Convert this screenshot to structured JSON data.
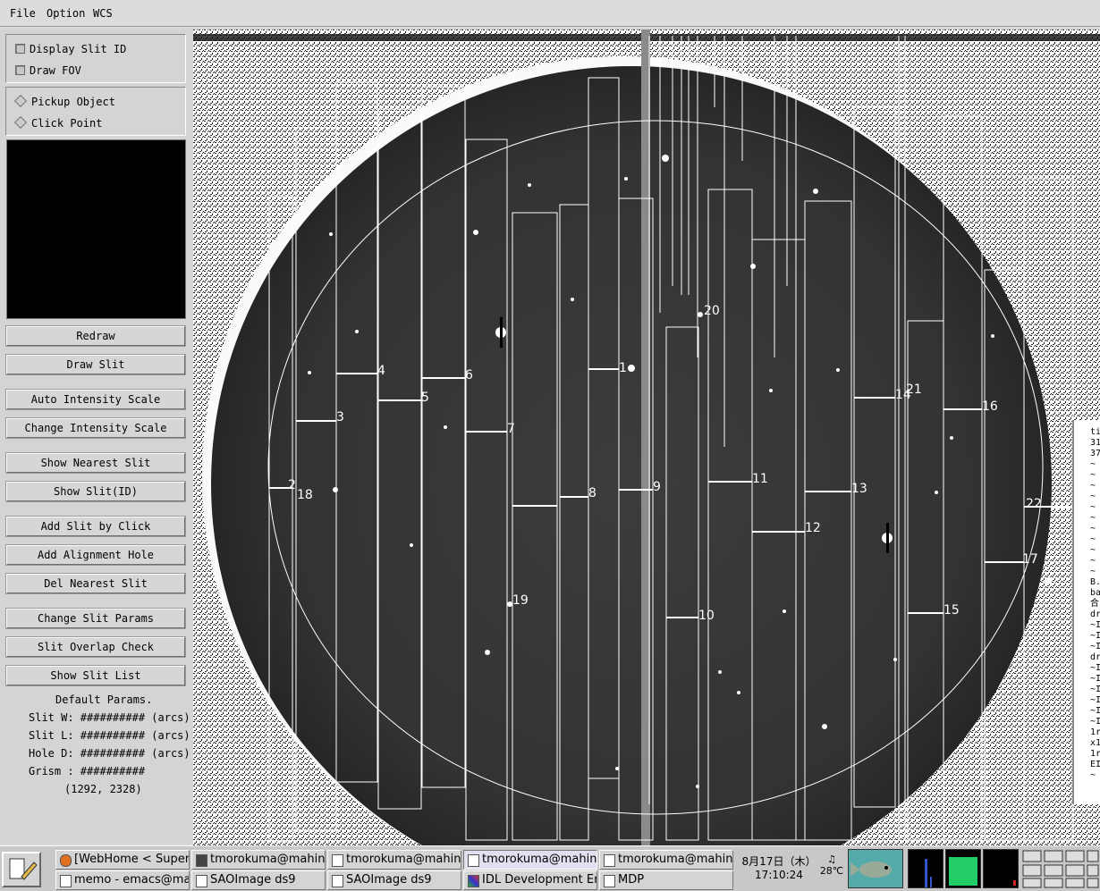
{
  "menu": [
    "File",
    "Option",
    "WCS"
  ],
  "options": {
    "display_slit_id": "Display Slit ID",
    "draw_fov": "Draw FOV",
    "pickup_object": "Pickup Object",
    "click_point": "Click Point"
  },
  "buttons": {
    "redraw": "Redraw",
    "draw_slit": "Draw Slit",
    "auto_intensity": "Auto Intensity Scale",
    "change_intensity": "Change Intensity Scale",
    "show_nearest": "Show Nearest Slit",
    "show_slit_id": "Show Slit(ID)",
    "add_slit_click": "Add Slit by Click",
    "add_alignment_hole": "Add Alignment Hole",
    "del_nearest": "Del Nearest Slit",
    "change_slit_params": "Change Slit Params",
    "overlap_check": "Slit Overlap Check",
    "show_slit_list": "Show Slit List"
  },
  "params": {
    "title": "Default Params.",
    "slit_w": "Slit W: ########## (arcs)",
    "slit_l": "Slit L: ########## (arcs)",
    "hole_d": "Hole D: ########## (arcs)",
    "grism": "Grism : ##########",
    "coords": "(1292, 2328)"
  },
  "slit_labels": [
    "1",
    "2",
    "3",
    "4",
    "5",
    "6",
    "7",
    "8",
    "9",
    "10",
    "11",
    "12",
    "13",
    "14",
    "15",
    "16",
    "17",
    "18",
    "19",
    "20",
    "21",
    "22"
  ],
  "terminal_peek": [
    "ti",
    "31",
    "37",
    "~",
    "~",
    "~",
    "~",
    "~",
    "~",
    "~",
    "~",
    "~",
    "~",
    "~",
    "B.",
    "ba",
    "合",
    "dr",
    "~I",
    "~I",
    "~I",
    "dr",
    "~I",
    "~I",
    "~I",
    "~I",
    "~I",
    "~I",
    "1r",
    "x1",
    "1r",
    "EI",
    "~"
  ],
  "taskbar": {
    "row1": [
      "[WebHome < Supern",
      "tmorokuma@mahina:",
      "tmorokuma@mahina:",
      "tmorokuma@mahina:",
      "tmorokuma@mahina:"
    ],
    "row2": [
      "memo - emacs@mah",
      "SAOImage ds9",
      "SAOImage ds9",
      "IDL Development Env",
      "MDP"
    ],
    "date": "8月17日（木）",
    "time": "17:10:24",
    "temp": "28℃"
  },
  "colors": {
    "panel": "#d4d4d4",
    "image_bg": "#2f2f2f",
    "overlay": "#ffffff"
  }
}
